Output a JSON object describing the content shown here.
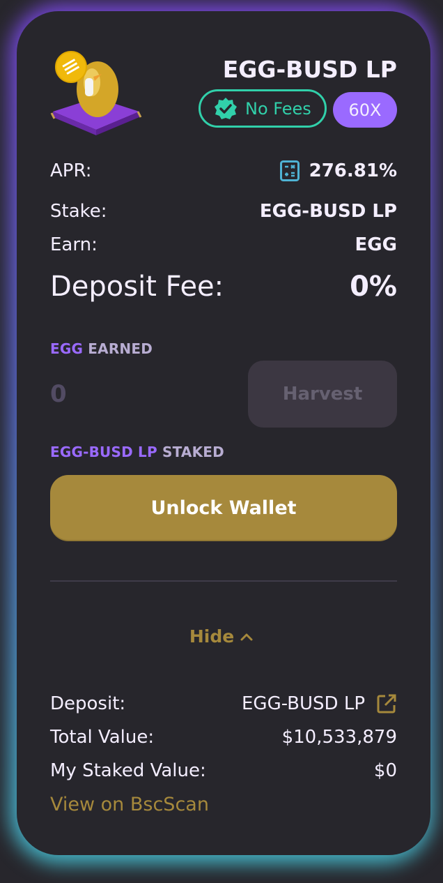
{
  "farm": {
    "title": "EGG-BUSD LP",
    "no_fees_label": "No Fees",
    "multiplier": "60X",
    "logo_icon": "golden-egg-on-cushion-icon",
    "token_badge_icon": "busd-coin-icon"
  },
  "stats": {
    "apr_label": "APR:",
    "apr_value": "276.81%",
    "stake_label": "Stake:",
    "stake_value": "EGG-BUSD LP",
    "earn_label": "Earn:",
    "earn_value": "EGG",
    "deposit_fee_label": "Deposit Fee:",
    "deposit_fee_value": "0%"
  },
  "earned": {
    "token": "EGG",
    "suffix": "EARNED",
    "value": "0",
    "harvest_label": "Harvest"
  },
  "staked": {
    "token": "EGG-BUSD LP",
    "suffix": "STAKED",
    "unlock_label": "Unlock Wallet"
  },
  "details": {
    "hide_label": "Hide",
    "deposit_label": "Deposit:",
    "deposit_value": "EGG-BUSD LP",
    "total_value_label": "Total Value:",
    "total_value": "$10,533,879",
    "my_staked_label": "My Staked Value:",
    "my_staked_value": "$0",
    "bscscan_label": "View on BscScan"
  },
  "colors": {
    "background": "#27262c",
    "text": "#f4eeff",
    "accent_purple": "#9a6aff",
    "accent_gold": "#a6893c",
    "success": "#31d0aa",
    "info": "#4fb3d4"
  }
}
